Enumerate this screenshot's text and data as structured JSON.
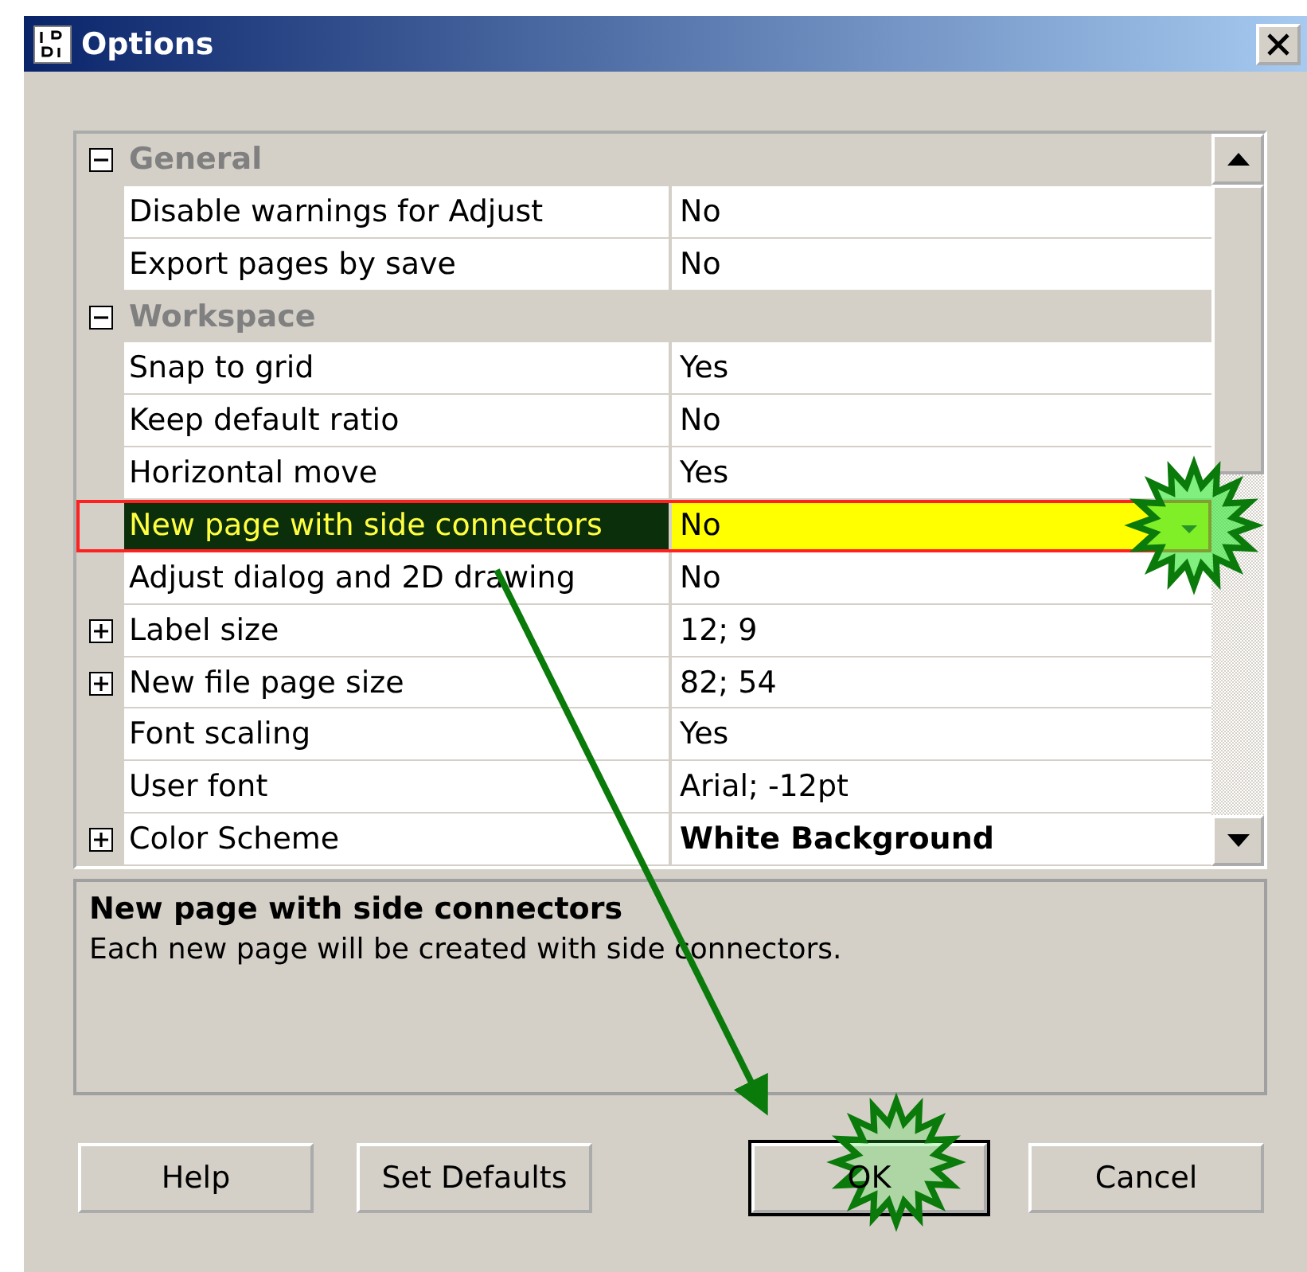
{
  "window": {
    "title": "Options"
  },
  "grid": {
    "rows": [
      {
        "kind": "category",
        "label": "General",
        "expanded": true
      },
      {
        "kind": "property",
        "label": "Disable warnings for Adjust",
        "value": "No",
        "selected": false,
        "bold": false
      },
      {
        "kind": "property",
        "label": "Export pages by save",
        "value": "No",
        "selected": false,
        "bold": false
      },
      {
        "kind": "category",
        "label": "Workspace",
        "expanded": true
      },
      {
        "kind": "property",
        "label": "Snap to grid",
        "value": "Yes",
        "selected": false,
        "bold": false
      },
      {
        "kind": "property",
        "label": "Keep default ratio",
        "value": "No",
        "selected": false,
        "bold": false
      },
      {
        "kind": "property",
        "label": "Horizontal move",
        "value": "Yes",
        "selected": false,
        "bold": false
      },
      {
        "kind": "property",
        "label": "New page with side connectors",
        "value": "No",
        "selected": true,
        "bold": false
      },
      {
        "kind": "property",
        "label": "Adjust dialog and 2D drawing",
        "value": "No",
        "selected": false,
        "bold": false
      },
      {
        "kind": "group",
        "label": "Label size",
        "value": "12; 9",
        "selected": false,
        "bold": false,
        "expanded": false
      },
      {
        "kind": "group",
        "label": "New file page size",
        "value": "82; 54",
        "selected": false,
        "bold": false,
        "expanded": false
      },
      {
        "kind": "property",
        "label": "Font scaling",
        "value": "Yes",
        "selected": false,
        "bold": false
      },
      {
        "kind": "property",
        "label": "User font",
        "value": "Arial; -12pt",
        "selected": false,
        "bold": false
      },
      {
        "kind": "group",
        "label": "Color Scheme",
        "value": "White Background",
        "selected": false,
        "bold": true,
        "expanded": false
      }
    ]
  },
  "description": {
    "title": "New page with side connectors",
    "text": "Each new page will be created with side connectors."
  },
  "buttons": [
    {
      "label": "Help",
      "default": false
    },
    {
      "label": "Set Defaults",
      "default": false
    },
    {
      "label": "OK",
      "default": true
    },
    {
      "label": "Cancel",
      "default": false
    }
  ]
}
